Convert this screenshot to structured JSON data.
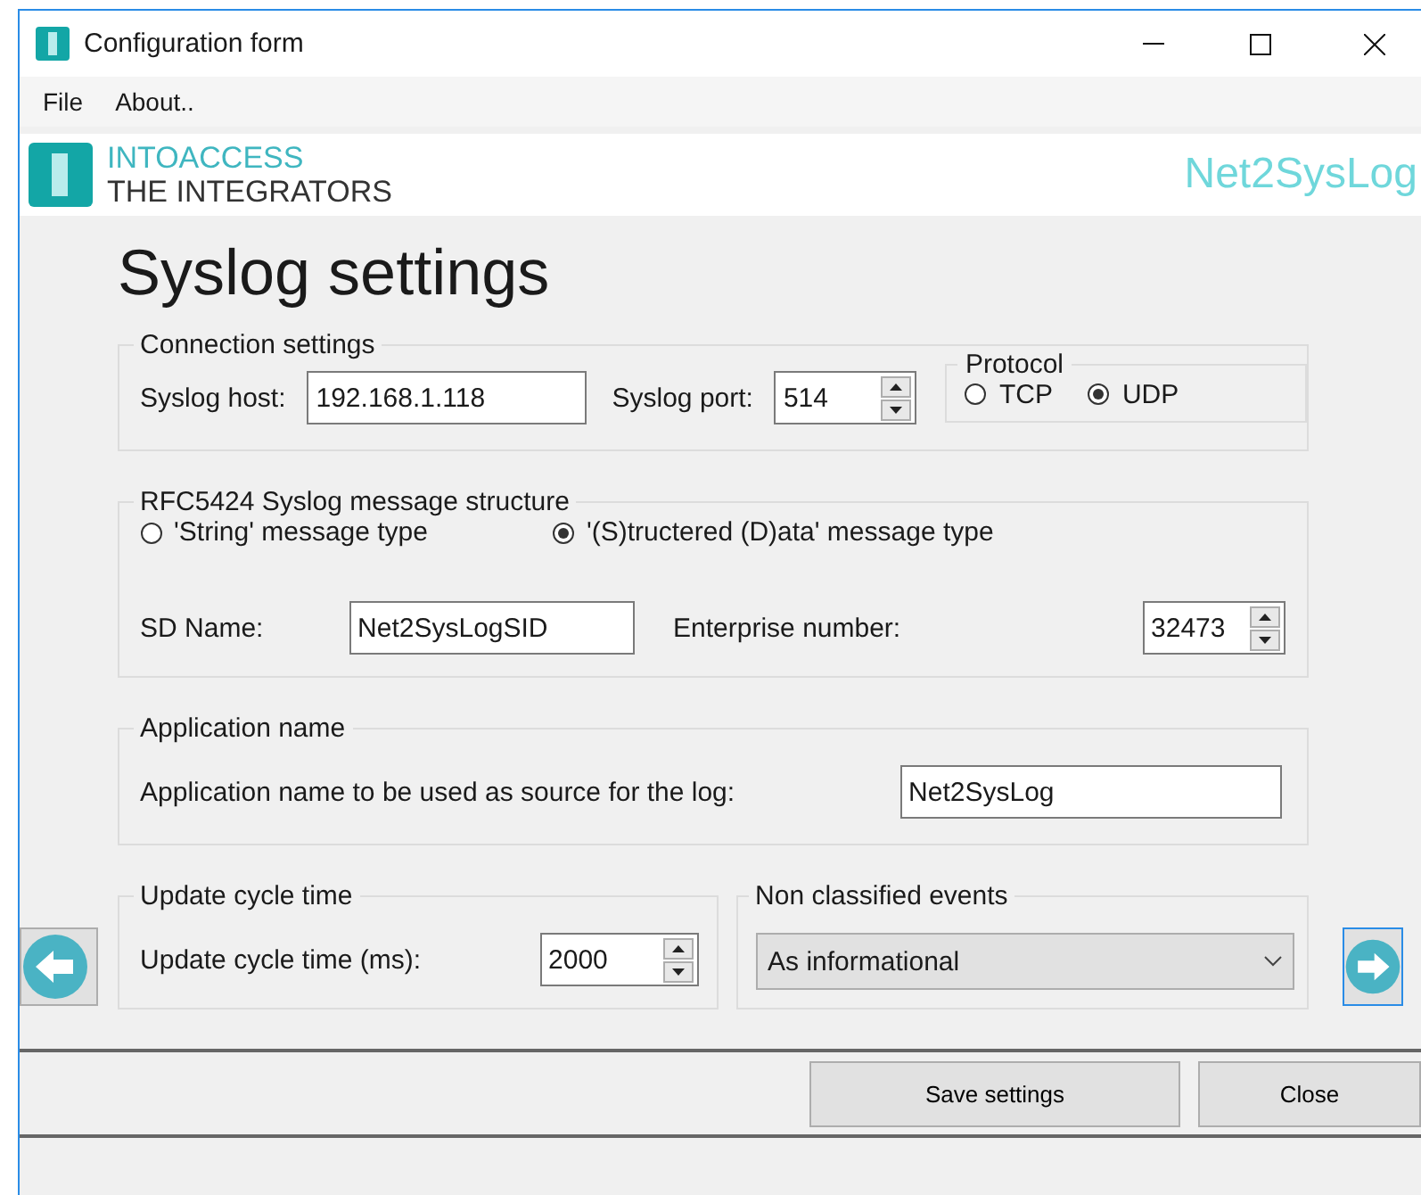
{
  "window": {
    "title": "Configuration form"
  },
  "menu": [
    {
      "label": "File"
    },
    {
      "label": "About.."
    }
  ],
  "brand": {
    "line1": "INTOACCESS",
    "line2": "THE INTEGRATORS",
    "product": "Net2SysLog"
  },
  "heading": "Syslog settings",
  "connection": {
    "title": "Connection settings",
    "host_label": "Syslog host:",
    "host_value": "192.168.1.118",
    "port_label": "Syslog port:",
    "port_value": "514"
  },
  "protocol": {
    "title": "Protocol",
    "options": [
      {
        "label": "TCP",
        "selected": false
      },
      {
        "label": "UDP",
        "selected": true
      }
    ]
  },
  "message_structure": {
    "title": "RFC5424 Syslog message structure",
    "types": [
      {
        "label": "'String' message type",
        "selected": false
      },
      {
        "label": "'(S)tructered (D)ata' message type",
        "selected": true
      }
    ],
    "sd_name_label": "SD Name:",
    "sd_name_value": "Net2SysLogSID",
    "enterprise_label": "Enterprise number:",
    "enterprise_value": "32473"
  },
  "application": {
    "title": "Application name",
    "label": "Application name to be used as source for the log:",
    "value": "Net2SysLog"
  },
  "update_cycle": {
    "title": "Update cycle time",
    "label": "Update cycle time (ms):",
    "value": "2000"
  },
  "non_classified": {
    "title": "Non classified events",
    "value": "As informational"
  },
  "buttons": [
    {
      "label": "Save settings"
    },
    {
      "label": "Close"
    }
  ]
}
